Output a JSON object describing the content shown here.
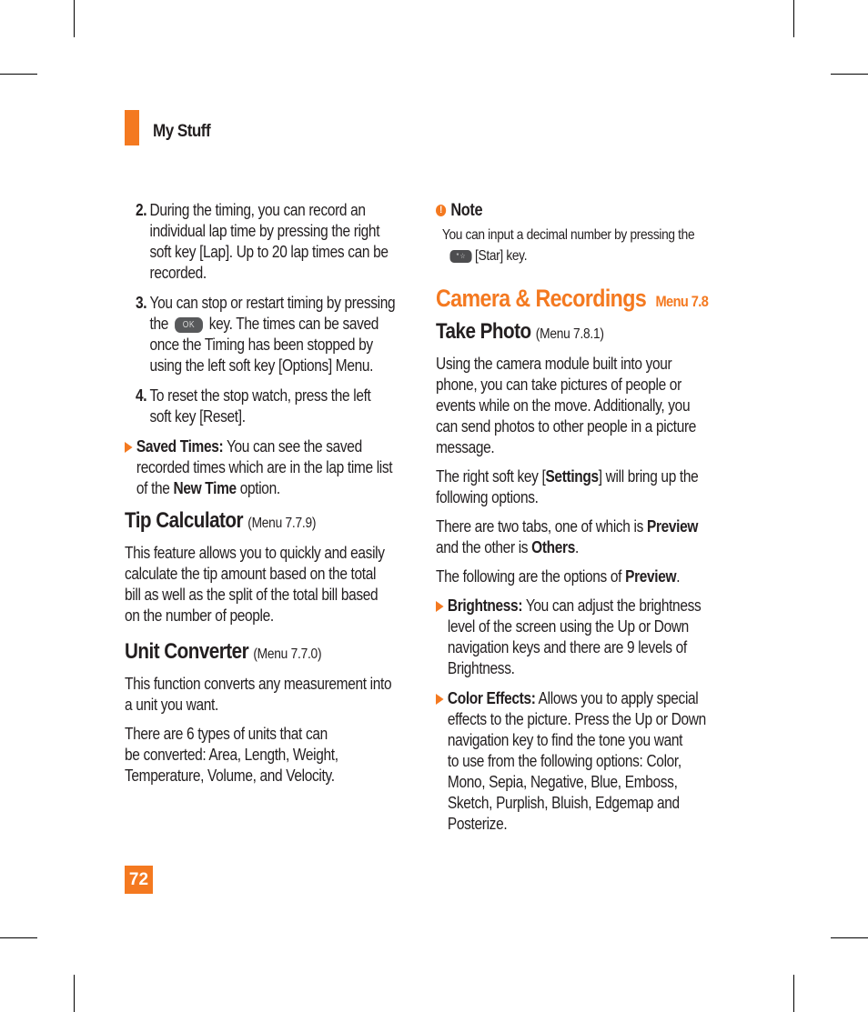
{
  "header": {
    "section_title": "My Stuff"
  },
  "left_column": {
    "numbered_items": [
      {
        "number": "2.",
        "lines": [
          "During the timing, you can record an",
          "individual lap time by pressing the right",
          "soft key [Lap]. Up to 20 lap times can be",
          "recorded."
        ]
      },
      {
        "number": "3.",
        "line1": "You can stop or restart timing by pressing",
        "line2_before": "the",
        "ok_key_label": "OK",
        "line2_after": "key. The times can be saved",
        "lines_rest": [
          "once the Timing has been stopped by",
          "using the left soft key [Options] Menu."
        ]
      },
      {
        "number": "4.",
        "lines": [
          "To reset the stop watch, press the left",
          "soft key [Reset]."
        ]
      }
    ],
    "saved_times": {
      "label": "Saved Times:",
      "line1_rest": " You can see the saved",
      "line2": "recorded times which are in the lap time list",
      "line3_before": "of the ",
      "line3_bold": "New Time",
      "line3_after": " option."
    },
    "tip_calculator": {
      "title": "Tip Calculator",
      "menu": "(Menu 7.7.9)",
      "lines": [
        "This feature allows you to quickly and easily",
        "calculate the tip amount based on the total",
        "bill as well as the split of the total bill based",
        "on the number of people."
      ]
    },
    "unit_converter": {
      "title": "Unit Converter",
      "menu": "(Menu 7.7.0)",
      "para1": [
        "This function converts any measurement into",
        "a unit you want."
      ],
      "para2": [
        "There are 6 types of units that can",
        "be converted: Area, Length, Weight,",
        "Temperature, Volume, and Velocity."
      ]
    }
  },
  "right_column": {
    "note": {
      "title": "Note",
      "line1": "You can input a decimal number by pressing the",
      "star_key_label": "* ☆",
      "line2_after": "[Star] key."
    },
    "camera_section": {
      "title": "Camera & Recordings",
      "menu": "Menu 7.8"
    },
    "take_photo": {
      "title": "Take Photo",
      "menu": "(Menu 7.8.1)",
      "para1": [
        "Using the camera module built into your",
        "phone, you can take pictures of people or",
        "events while on the move. Additionally, you",
        "can send photos to other people in a picture",
        "message."
      ],
      "para2_before": "The right soft key [",
      "para2_bold": "Settings",
      "para2_after": "] will bring up the",
      "para2_line2": "following options.",
      "para3_before": "There are two tabs, one of which is ",
      "para3_bold1": "Preview",
      "para3_line2_before": "and the other is ",
      "para3_bold2": "Others",
      "para3_end": ".",
      "para4_before": "The following are the options of ",
      "para4_bold": "Preview",
      "para4_end": "."
    },
    "bullets": [
      {
        "label": "Brightness:",
        "line1_rest": " You can adjust the brightness",
        "lines": [
          "level of the screen using the Up or Down",
          "navigation keys and there are 9 levels of",
          "Brightness."
        ]
      },
      {
        "label": "Color Effects:",
        "line1_rest": " Allows you to apply special",
        "lines": [
          "effects to the picture. Press the Up or Down",
          "navigation key to find the tone you want",
          "to use from the following options: Color,",
          "Mono, Sepia, Negative, Blue, Emboss,",
          "Sketch, Purplish, Bluish, Edgemap and",
          "Posterize."
        ]
      }
    ]
  },
  "footer": {
    "page_number": "72"
  },
  "colors": {
    "accent": "#f47920",
    "text": "#231f20"
  }
}
